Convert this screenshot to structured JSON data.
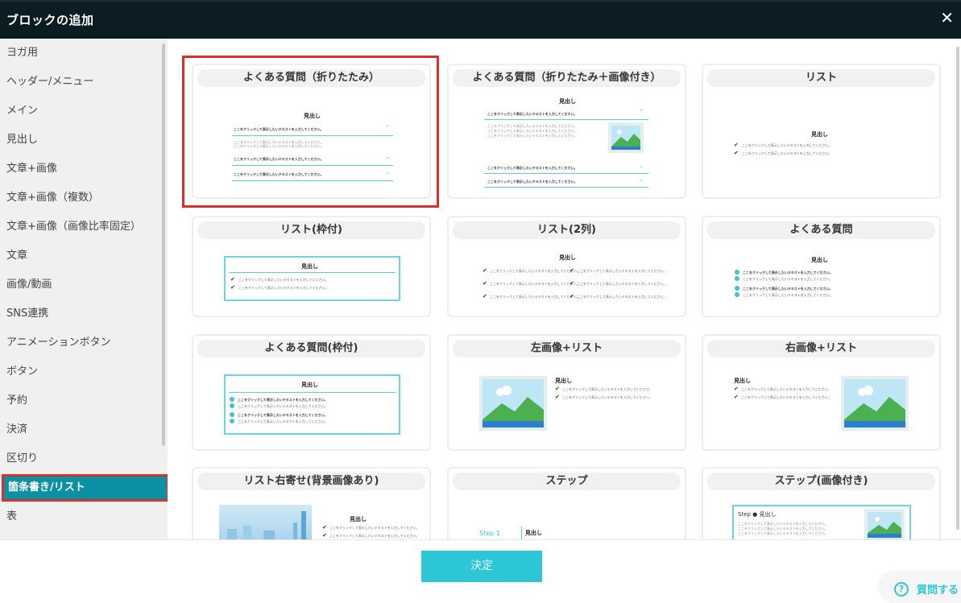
{
  "dialog": {
    "title": "ブロックの追加",
    "close_icon": "close-icon"
  },
  "sidebar": {
    "items": [
      {
        "label": "ヨガ用"
      },
      {
        "label": "ヘッダー/メニュー"
      },
      {
        "label": "メイン"
      },
      {
        "label": "見出し"
      },
      {
        "label": "文章+画像"
      },
      {
        "label": "文章+画像（複数）"
      },
      {
        "label": "文章+画像（画像比率固定）"
      },
      {
        "label": "文章"
      },
      {
        "label": "画像/動画"
      },
      {
        "label": "SNS連携"
      },
      {
        "label": "アニメーションボタン"
      },
      {
        "label": "ボタン"
      },
      {
        "label": "予約"
      },
      {
        "label": "決済"
      },
      {
        "label": "区切り"
      },
      {
        "label": "箇条書き/リスト"
      },
      {
        "label": "表"
      }
    ],
    "active_index": 15
  },
  "blocks": [
    {
      "title": "よくある質問（折りたたみ）",
      "selected": true
    },
    {
      "title": "よくある質問（折りたたみ＋画像付き）"
    },
    {
      "title": "リスト"
    },
    {
      "title": "リスト(枠付)"
    },
    {
      "title": "リスト(2列)"
    },
    {
      "title": "よくある質問"
    },
    {
      "title": "よくある質問(枠付)"
    },
    {
      "title": "左画像+リスト"
    },
    {
      "title": "右画像+リスト"
    },
    {
      "title": "リスト右寄せ(背景画像あり)"
    },
    {
      "title": "ステップ"
    },
    {
      "title": "ステップ(画像付き)"
    }
  ],
  "preview": {
    "heading": "見出し",
    "question_text": "ここをクリックして表示したいテキストを入力してください。",
    "list_text": "ここをクリックして表示したいテキストを入力してください。",
    "step_label": "Step 1",
    "step_heading": "Step ● 見出し"
  },
  "footer": {
    "decide_label": "決定",
    "help_label": "質問する",
    "help_icon": "question-icon"
  },
  "colors": {
    "accent": "#2cc6d6",
    "active": "#0b90a4",
    "selection": "#d9302c",
    "header": "#0b1c22"
  }
}
